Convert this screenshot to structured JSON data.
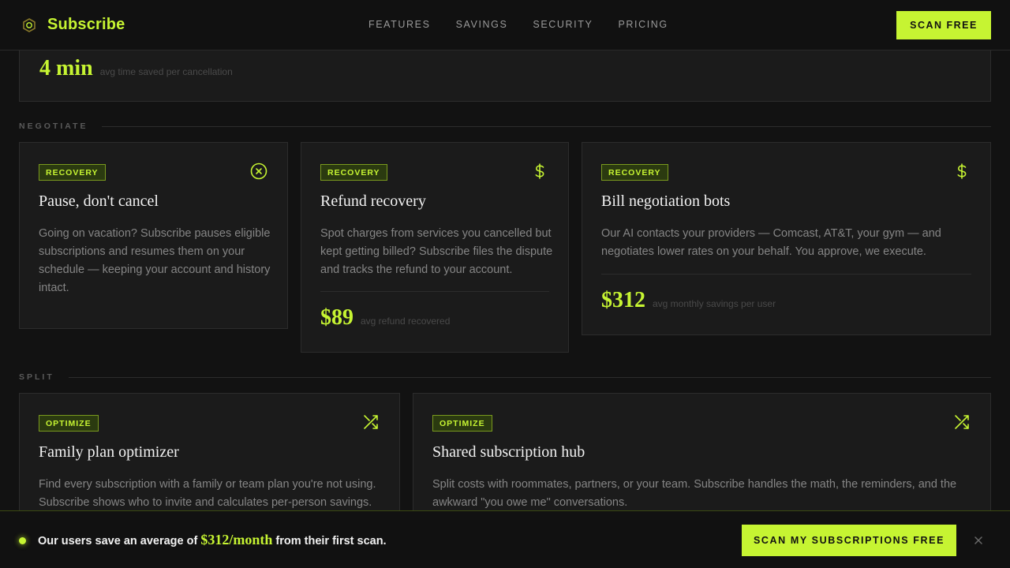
{
  "header": {
    "brand": "Subscribe",
    "nav": [
      "FEATURES",
      "SAVINGS",
      "SECURITY",
      "PRICING"
    ],
    "cta": "SCAN FREE"
  },
  "stat_panel": {
    "value": "4 min",
    "caption": "avg time saved per cancellation"
  },
  "sections": [
    {
      "label": "NEGOTIATE",
      "cards": [
        {
          "badge": "RECOVERY",
          "icon": "x-circle-icon",
          "title": "Pause, don't cancel",
          "desc": "Going on vacation? Subscribe pauses eligible subscriptions and resumes them on your schedule — keeping your account and history intact."
        },
        {
          "badge": "RECOVERY",
          "icon": "dollar-icon",
          "title": "Refund recovery",
          "desc": "Spot charges from services you cancelled but kept getting billed? Subscribe files the dispute and tracks the refund to your account.",
          "stat": "$89",
          "stat_caption": "avg refund recovered"
        },
        {
          "badge": "RECOVERY",
          "icon": "dollar-icon",
          "title": "Bill negotiation bots",
          "desc": "Our AI contacts your providers — Comcast, AT&T, your gym — and negotiates lower rates on your behalf. You approve, we execute.",
          "stat": "$312",
          "stat_caption": "avg monthly savings per user"
        }
      ]
    },
    {
      "label": "SPLIT",
      "cards": [
        {
          "badge": "OPTIMIZE",
          "icon": "shuffle-icon",
          "title": "Family plan optimizer",
          "desc": "Find every subscription with a family or team plan you're not using. Subscribe shows who to invite and calculates per-person savings."
        },
        {
          "badge": "OPTIMIZE",
          "icon": "shuffle-icon",
          "title": "Shared subscription hub",
          "desc": "Split costs with roommates, partners, or your team. Subscribe handles the math, the reminders, and the awkward \"you owe me\" conversations."
        }
      ]
    }
  ],
  "bottom_bar": {
    "text_before": "Our users save an average of",
    "amount": "$312/month",
    "text_after": "from their first scan.",
    "cta": "SCAN MY SUBSCRIPTIONS FREE",
    "close_icon": "close-icon"
  },
  "colors": {
    "accent": "#c6f432",
    "background": "#121212",
    "card": "#1b1b1b"
  }
}
